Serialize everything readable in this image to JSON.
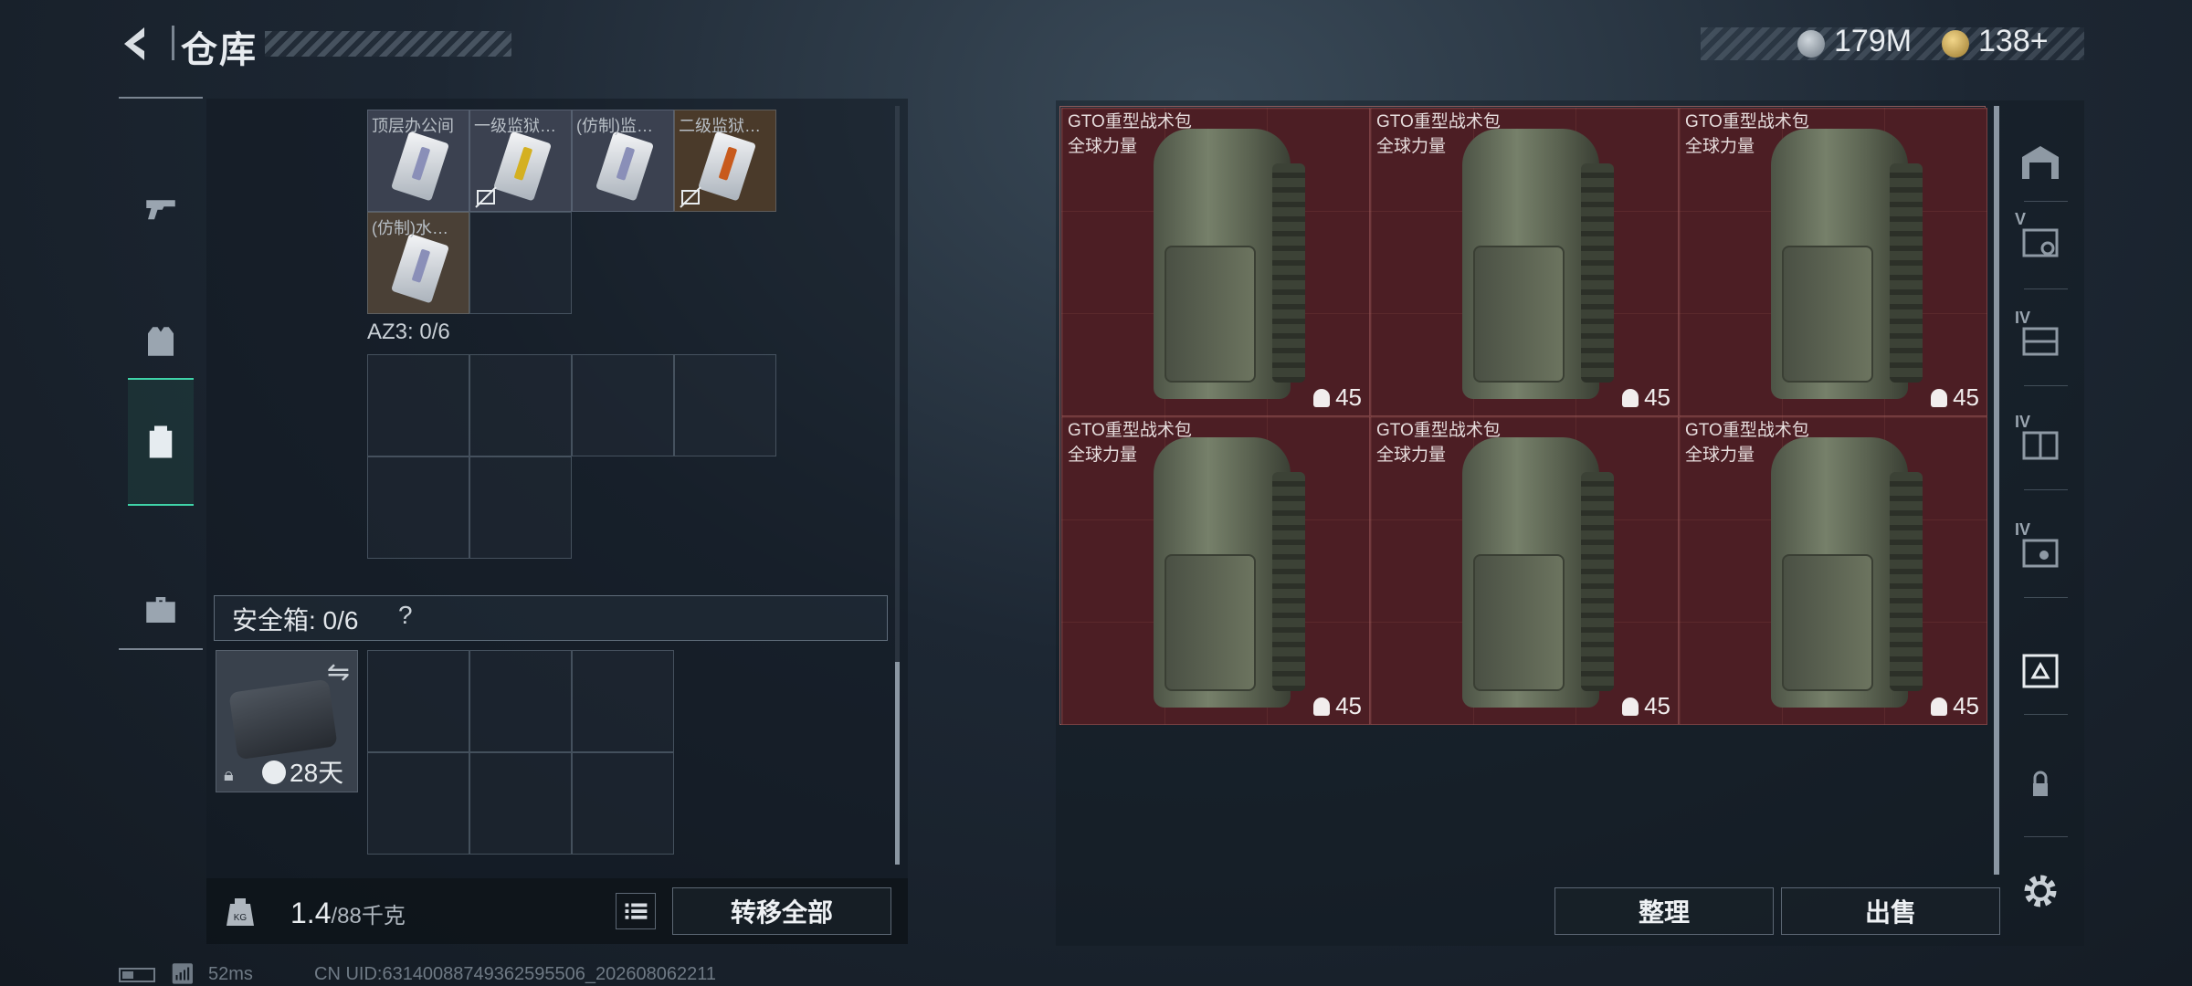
{
  "header": {
    "title": "仓库",
    "currency": [
      {
        "icon": "silver-coin-icon",
        "value": "179M"
      },
      {
        "icon": "gold-coin-icon",
        "value": "138+"
      }
    ]
  },
  "left_nav": [
    "weapon-tab",
    "armor-tab",
    "backpack-tab",
    "case-tab"
  ],
  "left_panel": {
    "items": [
      {
        "name": "顶层办公间",
        "stripe": "purple"
      },
      {
        "name": "一级监狱…",
        "stripe": "yellow",
        "no_sell": true
      },
      {
        "name": "(仿制)监…",
        "stripe": "purple"
      },
      {
        "name": "二级监狱…",
        "stripe": "orange",
        "no_sell": true
      },
      {
        "name": "(仿制)水…",
        "stripe": "purple"
      }
    ],
    "az3_label": "AZ3: 0/6",
    "safe_label": "安全箱: 0/6",
    "safe_help": "?",
    "safe_timer": "28天",
    "weight_value": "1.4",
    "weight_unit": "/88千克",
    "transfer_all": "转移全部"
  },
  "right_panel": {
    "bags": [
      {
        "name": "GTO重型战术包",
        "sub": "全球力量",
        "capacity": "45"
      },
      {
        "name": "GTO重型战术包",
        "sub": "全球力量",
        "capacity": "45"
      },
      {
        "name": "GTO重型战术包",
        "sub": "全球力量",
        "capacity": "45"
      },
      {
        "name": "GTO重型战术包",
        "sub": "全球力量",
        "capacity": "45"
      },
      {
        "name": "GTO重型战术包",
        "sub": "全球力量",
        "capacity": "45"
      },
      {
        "name": "GTO重型战术包",
        "sub": "全球力量",
        "capacity": "45"
      }
    ],
    "sort_label": "整理",
    "sell_label": "出售"
  },
  "right_nav": {
    "tiers": [
      "V",
      "IV",
      "IV",
      "IV"
    ]
  },
  "status": {
    "ping": "52ms",
    "uid": "CN UID:631400887493625955​06_202608062211"
  }
}
